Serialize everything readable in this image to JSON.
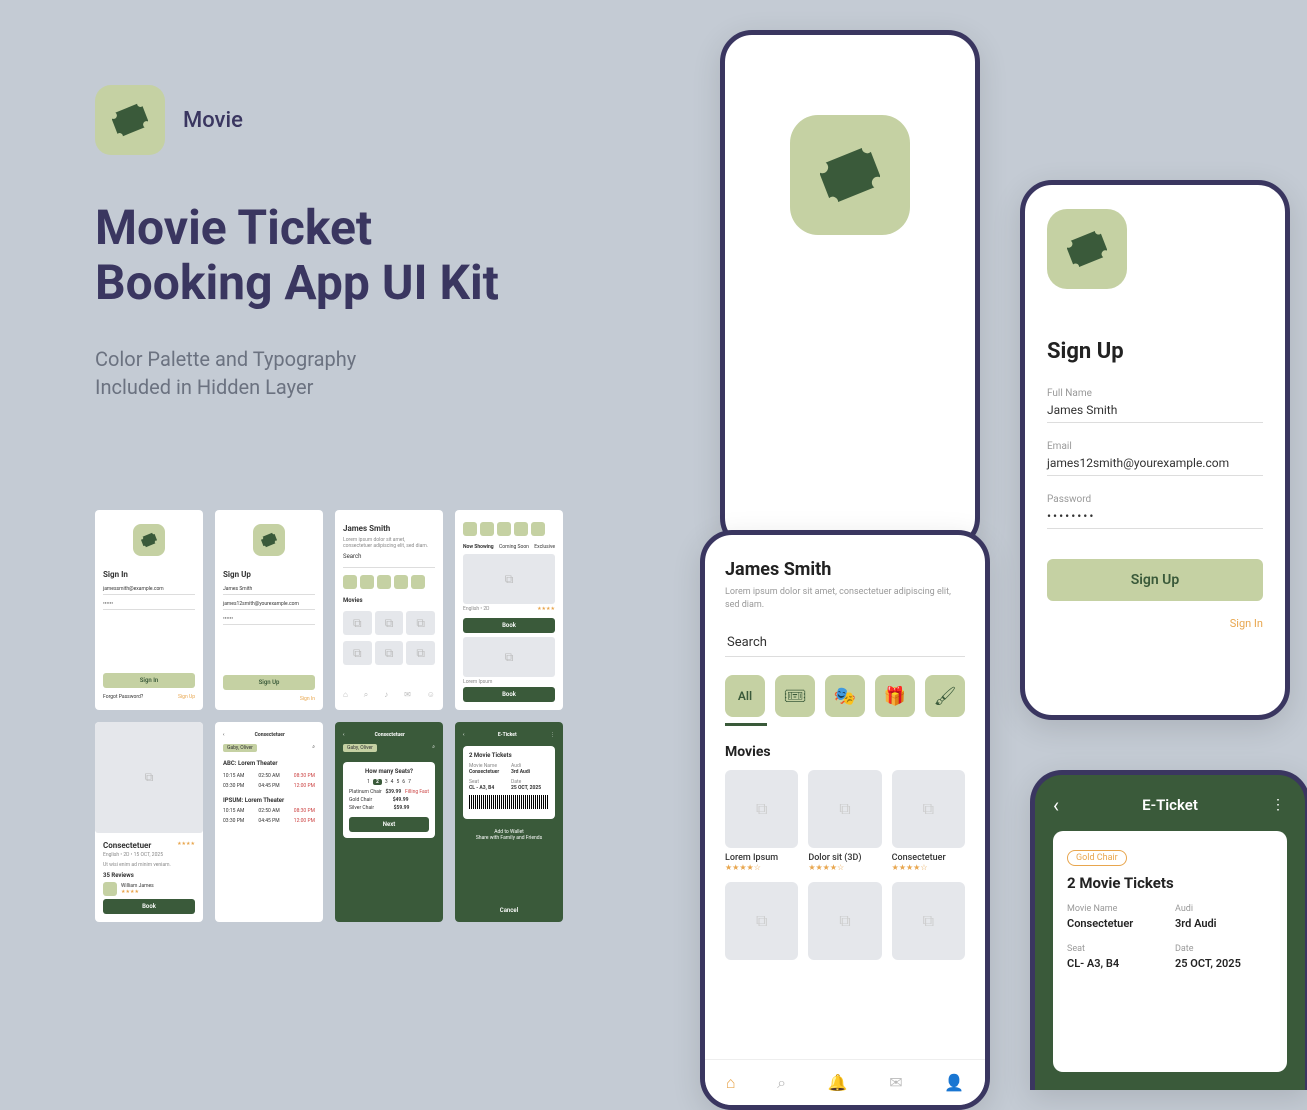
{
  "brand": {
    "name": "Movie"
  },
  "headline": "Movie Ticket\nBooking App UI Kit",
  "subhead": "Color Palette and Typography\nIncluded in Hidden Layer",
  "signup": {
    "title": "Sign Up",
    "fullname_label": "Full Name",
    "fullname_value": "James Smith",
    "email_label": "Email",
    "email_value": "james12smith@yourexample.com",
    "password_label": "Password",
    "password_value": "••••••••",
    "button": "Sign Up",
    "signin_link": "Sign In"
  },
  "home": {
    "user": "James Smith",
    "lorem": "Lorem ipsum dolor sit amet, consectetuer adipiscing elit, sed diam.",
    "search_label": "Search",
    "cat_all": "All",
    "movies_heading": "Movies",
    "movies": [
      {
        "title": "Lorem Ipsum",
        "stars": "★★★★☆"
      },
      {
        "title": "Dolor sit (3D)",
        "stars": "★★★★☆"
      },
      {
        "title": "Consectetuer",
        "stars": "★★★★☆"
      }
    ]
  },
  "eticket": {
    "heading": "E-Ticket",
    "badge": "Gold Chair",
    "title": "2 Movie Tickets",
    "movie_label": "Movie Name",
    "movie_value": "Consectetuer",
    "audi_label": "Audi",
    "audi_value": "3rd Audi",
    "seat_label": "Seat",
    "seat_value": "CL- A3, B4",
    "date_label": "Date",
    "date_value": "25 OCT, 2025"
  },
  "thumbs": {
    "signin_title": "Sign In",
    "signin_email": "jamessmith@example.com",
    "signin_pass": "••••••",
    "signin_btn": "Sign In",
    "forgot": "Forgot Password?",
    "signup_link": "Sign Up",
    "signup_title": "Sign Up",
    "signup_name": "James Smith",
    "signup_email": "james12smith@yourexample.com",
    "signup_btn": "Sign Up",
    "signin_link": "Sign In",
    "home_user": "James Smith",
    "home_search": "Search",
    "home_movies": "Movies",
    "tabs1": "Now Showing",
    "tabs2": "Coming Soon",
    "tabs3": "Exclusive",
    "book": "Book",
    "detail_title": "Consectetuer",
    "detail_meta": "English  •  2D  •  15 OCT, 2025",
    "detail_body": "Ut wisi enim ad minim veniam.",
    "reviews": "35 Reviews",
    "reviewer": "William James",
    "thr_title": "Consectetuer",
    "thr_loc": "Gaby, Oliver",
    "thr1": "ABC: Lorem Theater",
    "thr2": "IPSUM: Lorem Theater",
    "t1": "10:15 AM",
    "t2": "02:50 AM",
    "t3": "08:30 PM",
    "t4": "03:30 PM",
    "t5": "04:45 PM",
    "t6": "12:00 PM",
    "t7": "10:15 AM",
    "t8": "02:50 AM",
    "t9": "08:30 PM",
    "t10": "03:30 PM",
    "t11": "04:45 PM",
    "t12": "12:00 PM",
    "seats_title": "Consectetuer",
    "seats_q": "How many Seats?",
    "platinum": "Platinum Chair",
    "p_price": "$39.99",
    "p_status": "Filling Fast",
    "gold": "Gold Chair",
    "g_price": "$49.99",
    "silver": "Silver Chair",
    "s_price": "$59.99",
    "next": "Next",
    "et_title": "E-Ticket",
    "et_tickets": "2 Movie Tickets",
    "et_seat": "CL - A3, B4",
    "et_date": "25 OCT, 2025",
    "et_wallet": "Add to Wallet",
    "et_share": "Share with Family and Friends",
    "et_cancel": "Cancel"
  }
}
